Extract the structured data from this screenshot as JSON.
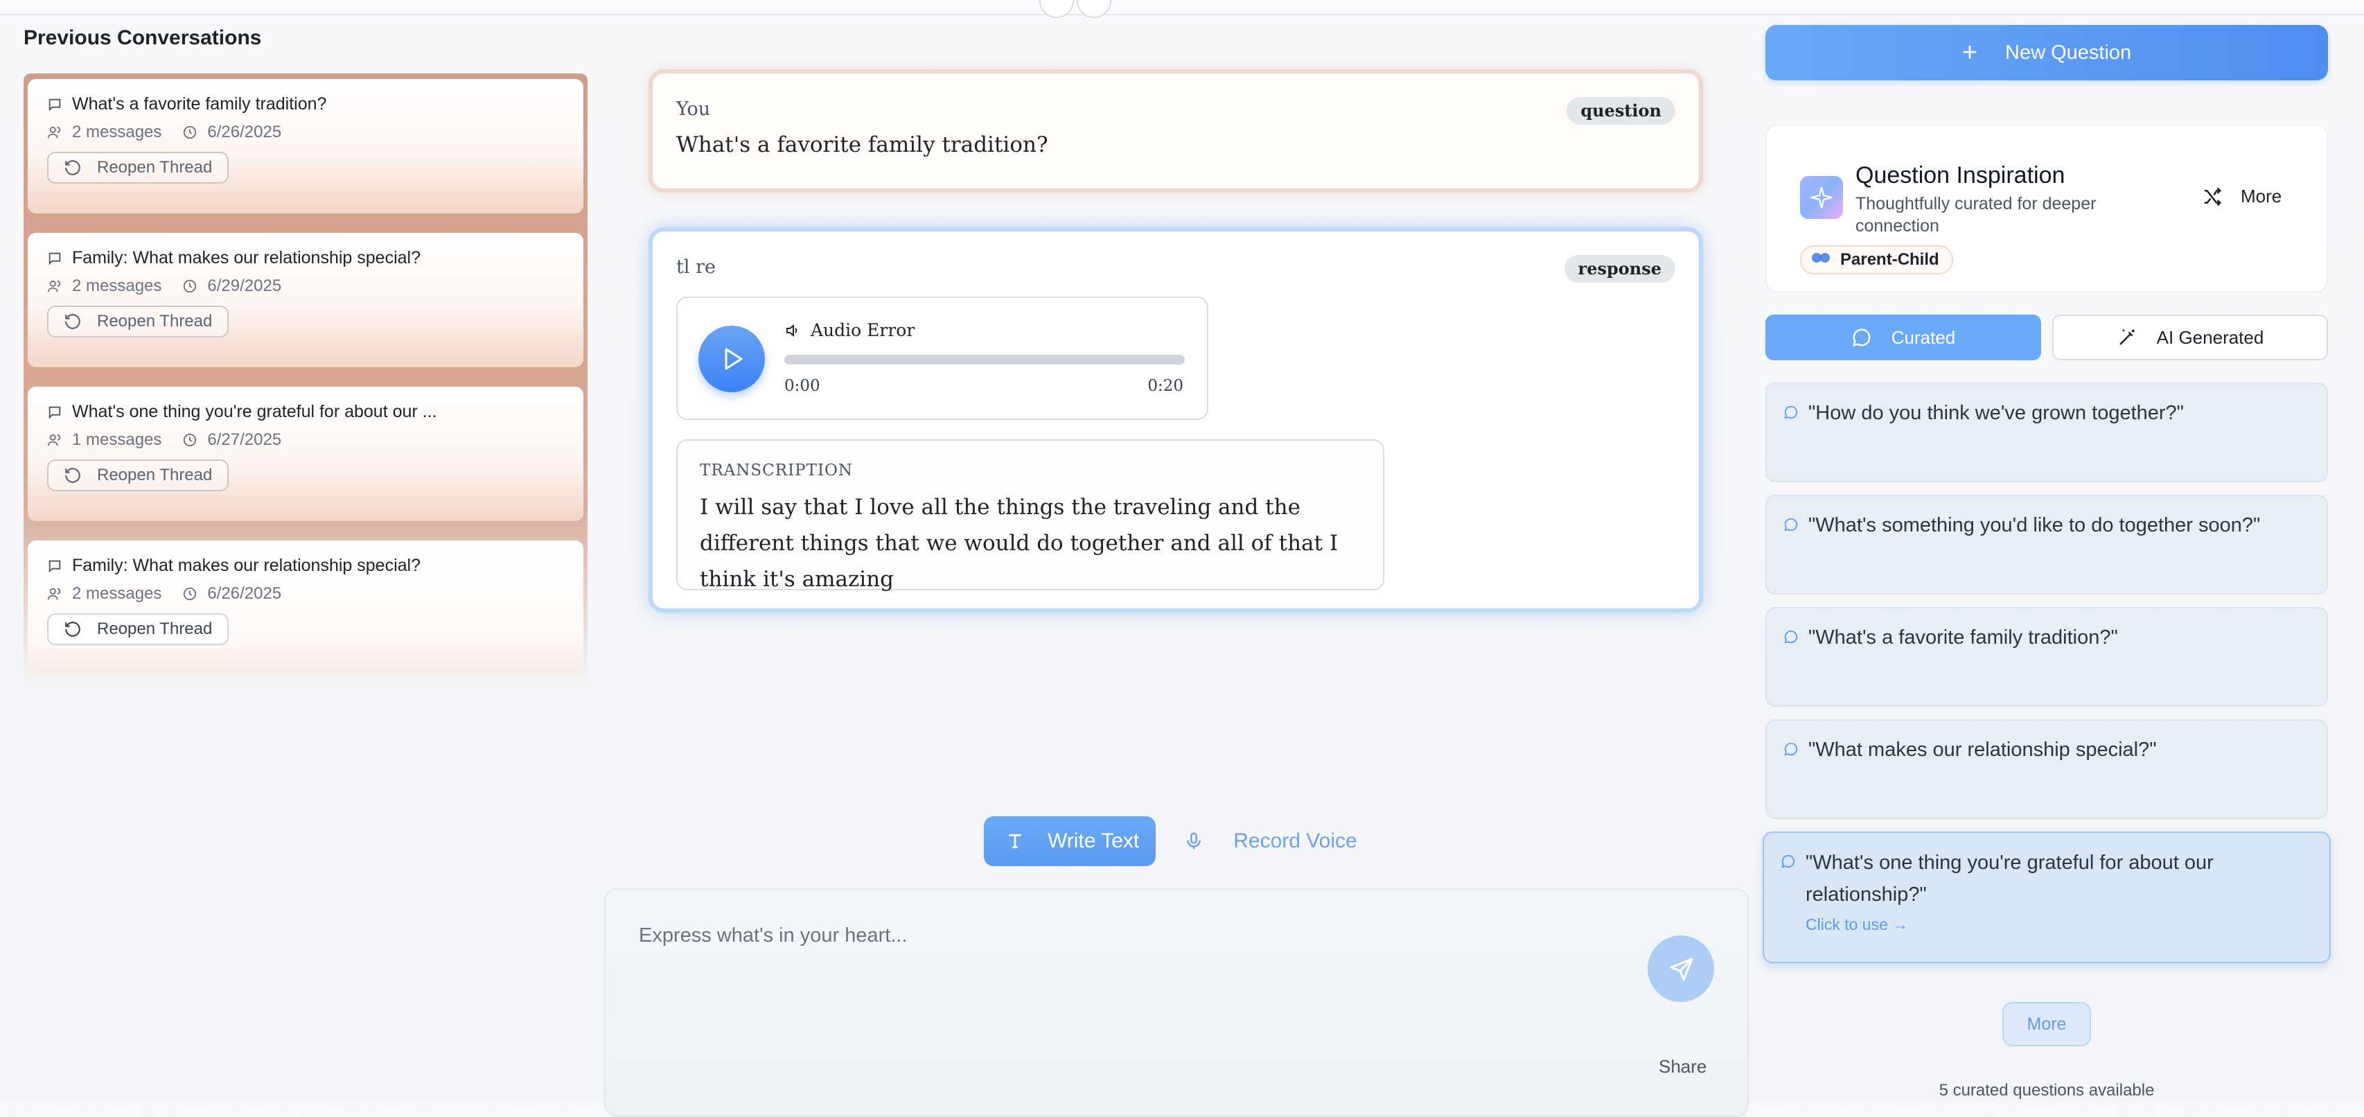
{
  "sidebar": {
    "title": "Previous Conversations",
    "conversations": [
      {
        "title": "What's a favorite family tradition?",
        "messages": "2 messages",
        "date": "6/26/2025",
        "action": "Reopen Thread"
      },
      {
        "title": "Family: What makes our relationship special?",
        "messages": "2 messages",
        "date": "6/29/2025",
        "action": "Reopen Thread"
      },
      {
        "title": "What's one thing you're grateful for about our ...",
        "messages": "1 messages",
        "date": "6/27/2025",
        "action": "Reopen Thread"
      },
      {
        "title": "Family: What makes our relationship special?",
        "messages": "2 messages",
        "date": "6/26/2025",
        "action": "Reopen Thread"
      }
    ]
  },
  "thread": {
    "question": {
      "author": "You",
      "tag": "question",
      "text": "What's a favorite family tradition?"
    },
    "response": {
      "author": "tl re",
      "tag": "response",
      "audio": {
        "label": "Audio Error",
        "current": "0:00",
        "duration": "0:20",
        "progress": 0
      },
      "transcription_label": "TRANSCRIPTION",
      "transcription": "I will say that I love all the things the traveling and the different things that we would do together and all of that I think it's amazing"
    }
  },
  "composer": {
    "mode_write": "Write Text",
    "mode_voice": "Record Voice",
    "placeholder": "Express what's in your heart...",
    "share": "Share"
  },
  "right": {
    "new_question": "New Question",
    "inspiration": {
      "title": "Question Inspiration",
      "subtitle": "Thoughtfully curated for deeper connection",
      "more": "More",
      "badge": "Parent-Child"
    },
    "tabs": {
      "curated": "Curated",
      "ai": "AI Generated"
    },
    "questions": [
      "\"How do you think we've grown together?\"",
      "\"What's something you'd like to do together soon?\"",
      "\"What's a favorite family tradition?\"",
      "\"What makes our relationship special?\"",
      "\"What's one thing you're grateful for about our relationship?\""
    ],
    "use_hint": "Click to use →",
    "more_button": "More",
    "count_text": "5 curated questions available"
  },
  "colors": {
    "accent": "#5a9cf2",
    "question_border": "#f0d7cc",
    "response_border": "#bcd8fb"
  }
}
